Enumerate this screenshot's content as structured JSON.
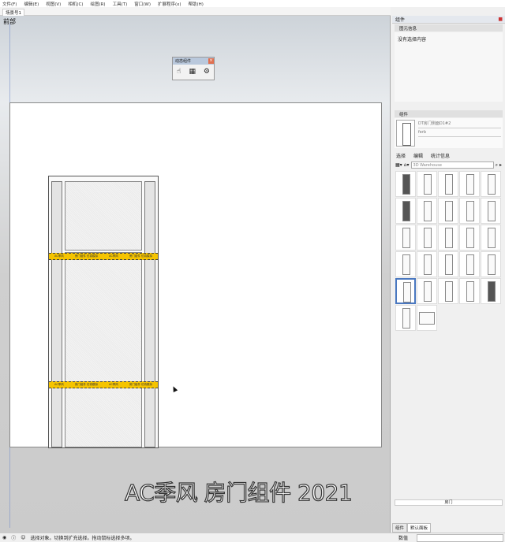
{
  "menu": [
    "文件(F)",
    "编辑(E)",
    "视图(V)",
    "相机(C)",
    "绘图(R)",
    "工具(T)",
    "窗口(W)",
    "扩展程序(x)",
    "帮助(H)"
  ],
  "scene_tab": "场景号1",
  "viewport": {
    "view_label": "前部",
    "band_text": [
      "AC季风",
      "房门组件 仿真模拟",
      "AC季风",
      "房门组件 仿真模拟"
    ]
  },
  "dyn_toolbar": {
    "title": "动态组件",
    "icons": [
      "interact-icon",
      "component-options-icon",
      "component-attributes-icon"
    ]
  },
  "watermark": "AC季风 房门组件 2021",
  "panel": {
    "title": "组件",
    "entity_section": "图元信息",
    "entity_text": "没有选择内容",
    "component_section": "组件",
    "component_name": "DT房门侧面D1#2",
    "component_desc": "ferb",
    "tabs": [
      "选择",
      "编辑",
      "统计信息"
    ],
    "search_placeholder": "3D Warehouse",
    "selected_name": "房门",
    "bottom_tabs": [
      "组件",
      "默认面板"
    ]
  },
  "status": {
    "text": "选择对象。切换到扩充选择。拖动鼠标选择多项。",
    "measure_label": "数值"
  }
}
